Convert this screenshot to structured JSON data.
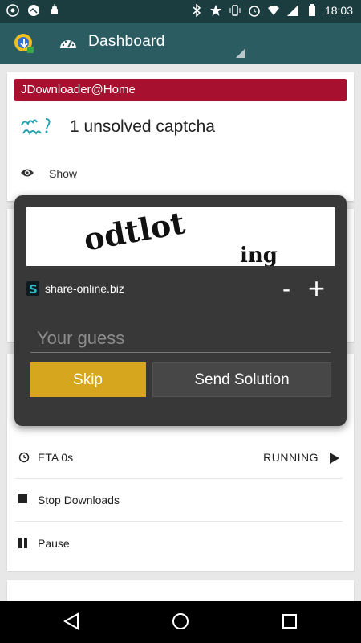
{
  "status_bar": {
    "time": "18:03",
    "left_icons": [
      "chrome-icon",
      "gallery-icon",
      "android-debug-icon"
    ],
    "right_icons": [
      "bluetooth-icon",
      "star-icon",
      "vibrate-icon",
      "alarm-icon",
      "wifi-icon",
      "signal-icon",
      "battery-icon"
    ]
  },
  "app_bar": {
    "title": "Dashboard",
    "logo_icon": "jdownloader-logo-icon",
    "title_icon": "dashboard-icon"
  },
  "device_card": {
    "device_name": "JDownloader@Home",
    "captcha_summary": "1 unsolved captcha",
    "show_label": "Show"
  },
  "download_card": {
    "eta_label": "ETA 0s",
    "state_label": "RUNNING",
    "stop_label": "Stop Downloads",
    "pause_label": "Pause"
  },
  "captcha_dialog": {
    "hoster": "share-online.biz",
    "minus_label": "-",
    "plus_label": "+",
    "guess_placeholder": "Your guess",
    "skip_label": "Skip",
    "send_label": "Send Solution",
    "captcha_text_1": "odtlot",
    "captcha_text_2": "ing"
  },
  "colors": {
    "status_bar": "#1c3d40",
    "app_bar": "#2b5c61",
    "device_bar": "#a8102f",
    "skip_button": "#d5a61e",
    "dialog": "#383838"
  }
}
